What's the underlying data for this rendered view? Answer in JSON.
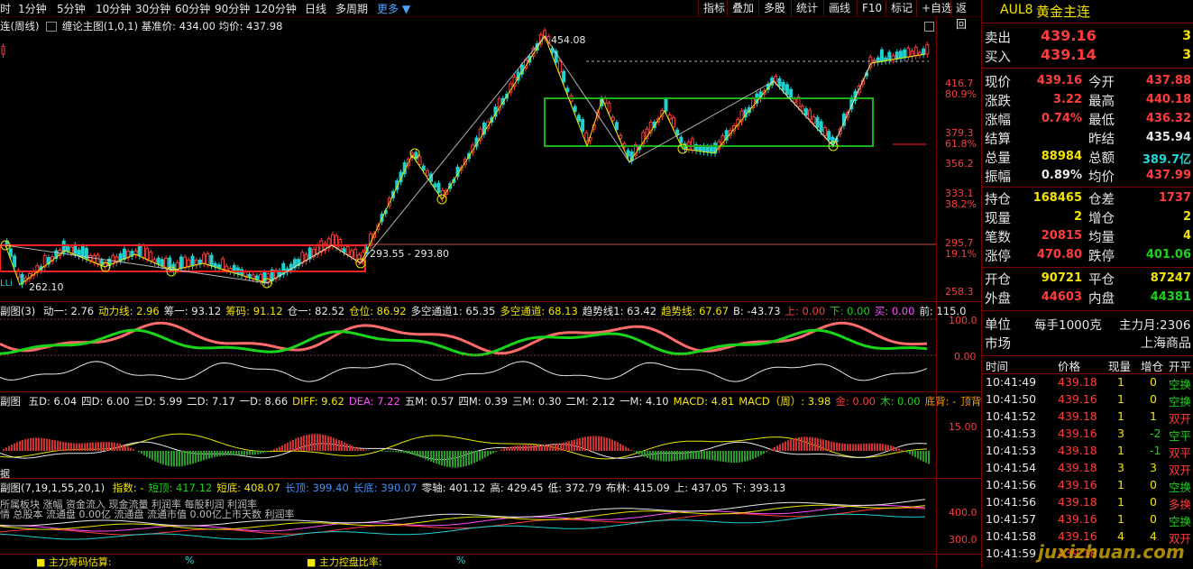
{
  "toolbar": {
    "periods": [
      "时",
      "1分钟",
      "5分钟",
      "10分钟",
      "30分钟",
      "60分钟",
      "90分钟",
      "120分钟",
      "日线",
      "多周期"
    ],
    "more": "更多",
    "tools": [
      "指标",
      "叠加",
      "多股",
      "统计",
      "画线",
      "F10",
      "标记",
      "+自选",
      "返回"
    ]
  },
  "main_pane": {
    "title_left": "连(周线)",
    "title_indicator": "缠论主图(1,0,1)",
    "title_base": "基准价: 434.00",
    "title_avg": "均价: 437.98",
    "axis_labels": [
      "416.7",
      "80.9%",
      "379.3",
      "61.8%",
      "356.2",
      "333.1",
      "38.2%",
      "295.7",
      "19.1%",
      "258.3"
    ],
    "annot_high": "454.08",
    "annot_low": "262.10",
    "annot_range": "293.55 - 293.80",
    "corner_text": "LLi"
  },
  "sub1": {
    "name": "副图(3)",
    "items": [
      {
        "k": "动一:",
        "v": "2.76",
        "c": "#e8e8e8"
      },
      {
        "k": "动力线:",
        "v": "2.96",
        "c": "#f5e400"
      },
      {
        "k": "筹一:",
        "v": "93.12",
        "c": "#e8e8e8"
      },
      {
        "k": "筹码:",
        "v": "91.12",
        "c": "#f5e400"
      },
      {
        "k": "仓一:",
        "v": "82.52",
        "c": "#e8e8e8"
      },
      {
        "k": "仓位:",
        "v": "86.92",
        "c": "#f5e400"
      },
      {
        "k": "多空通道1:",
        "v": "65.35",
        "c": "#e8e8e8"
      },
      {
        "k": "多空通道:",
        "v": "68.13",
        "c": "#f5e400"
      },
      {
        "k": "趋势线1:",
        "v": "63.42",
        "c": "#e8e8e8"
      },
      {
        "k": "趋势线:",
        "v": "67.67",
        "c": "#f5e400"
      },
      {
        "k": "B:",
        "v": "-43.73",
        "c": "#e8e8e8"
      },
      {
        "k": "上:",
        "v": "0.00",
        "c": "#ff3c3c"
      },
      {
        "k": "下:",
        "v": "0.00",
        "c": "#19d519"
      },
      {
        "k": "买:",
        "v": "0.00",
        "c": "#ff4dff"
      },
      {
        "k": "前:",
        "v": "115.0",
        "c": "#e8e8e8"
      }
    ],
    "axis": [
      "100.0",
      "0.00"
    ]
  },
  "sub2": {
    "name": "副图",
    "items": [
      {
        "k": "五D:",
        "v": "6.04",
        "c": "#e8e8e8"
      },
      {
        "k": "四D:",
        "v": "6.00",
        "c": "#e8e8e8"
      },
      {
        "k": "三D:",
        "v": "5.99",
        "c": "#e8e8e8"
      },
      {
        "k": "二D:",
        "v": "7.17",
        "c": "#e8e8e8"
      },
      {
        "k": "一D:",
        "v": "8.66",
        "c": "#e8e8e8"
      },
      {
        "k": "DIFF:",
        "v": "9.62",
        "c": "#f5e400"
      },
      {
        "k": "DEA:",
        "v": "7.22",
        "c": "#ff4dff"
      },
      {
        "k": "五M:",
        "v": "0.57",
        "c": "#e8e8e8"
      },
      {
        "k": "四M:",
        "v": "0.39",
        "c": "#e8e8e8"
      },
      {
        "k": "三M:",
        "v": "0.30",
        "c": "#e8e8e8"
      },
      {
        "k": "二M:",
        "v": "2.12",
        "c": "#e8e8e8"
      },
      {
        "k": "一M:",
        "v": "4.10",
        "c": "#e8e8e8"
      },
      {
        "k": "MACD:",
        "v": "4.81",
        "c": "#f5e400"
      },
      {
        "k": "MACD（周）:",
        "v": "3.98",
        "c": "#f5e400"
      },
      {
        "k": "金:",
        "v": "0.00",
        "c": "#ff3c3c"
      },
      {
        "k": "木:",
        "v": "0.00",
        "c": "#19d519"
      },
      {
        "k": "底背:",
        "v": "-",
        "c": "#ff9c00"
      },
      {
        "k": "顶背",
        "v": "",
        "c": "#ff9c00"
      }
    ],
    "axis": "15.00",
    "corner": "据"
  },
  "sub3": {
    "name": "副图(7,19,1,55,20,1)",
    "items": [
      {
        "k": "指数:",
        "v": "-",
        "c": "#f5e400"
      },
      {
        "k": "短顶:",
        "v": "417.12",
        "c": "#19d519"
      },
      {
        "k": "短底:",
        "v": "408.07",
        "c": "#f5e400"
      },
      {
        "k": "长顶:",
        "v": "399.40",
        "c": "#3f8fff"
      },
      {
        "k": "长底:",
        "v": "390.07",
        "c": "#3f8fff"
      },
      {
        "k": "零轴:",
        "v": "401.12",
        "c": "#e8e8e8"
      },
      {
        "k": "高:",
        "v": "429.45",
        "c": "#e8e8e8"
      },
      {
        "k": "低:",
        "v": "372.79",
        "c": "#e8e8e8"
      },
      {
        "k": "布林:",
        "v": "415.09",
        "c": "#e8e8e8"
      },
      {
        "k": "上:",
        "v": "437.05",
        "c": "#e8e8e8"
      },
      {
        "k": "下:",
        "v": "393.13",
        "c": "#e8e8e8"
      }
    ],
    "overlay1": "所属板块 涨幅 资金流入 现金流量 利润率 每股利润 利润率",
    "overlay2": "情 总股本 流通盘 0.00亿 流通盘 流通市值 0.00亿上市天数 利润率",
    "axis": [
      "400.0",
      "300.0"
    ],
    "footer1_label": "主力筹码估算:",
    "footer1_value": "%",
    "footer2_label": "主力控盘比率:",
    "footer2_value": "%"
  },
  "quote": {
    "code": "AUL8",
    "name": "黄金主连",
    "sell_label": "卖出",
    "sell_price": "439.16",
    "sell_vol": "3",
    "buy_label": "买入",
    "buy_price": "439.14",
    "buy_vol": "3",
    "rows": [
      {
        "l1": "现价",
        "v1": "439.16",
        "c1": "#ff3c3c",
        "l2": "今开",
        "v2": "437.88",
        "c2": "#ff3c3c"
      },
      {
        "l1": "涨跌",
        "v1": "3.22",
        "c1": "#ff3c3c",
        "l2": "最高",
        "v2": "440.18",
        "c2": "#ff3c3c"
      },
      {
        "l1": "涨幅",
        "v1": "0.74%",
        "c1": "#ff3c3c",
        "l2": "最低",
        "v2": "436.32",
        "c2": "#ff3c3c"
      },
      {
        "l1": "结算",
        "v1": "",
        "c1": "#e8e8e8",
        "l2": "昨结",
        "v2": "435.94",
        "c2": "#e8e8e8"
      },
      {
        "l1": "总量",
        "v1": "88984",
        "c1": "#f5e400",
        "l2": "总额",
        "v2": "389.7亿",
        "c2": "#23d6d6"
      },
      {
        "l1": "振幅",
        "v1": "0.89%",
        "c1": "#e8e8e8",
        "l2": "均价",
        "v2": "437.99",
        "c2": "#ff3c3c"
      }
    ],
    "rows2": [
      {
        "l1": "持仓",
        "v1": "168465",
        "c1": "#f5e400",
        "l2": "仓差",
        "v2": "1737",
        "c2": "#ff3c3c"
      },
      {
        "l1": "现量",
        "v1": "2",
        "c1": "#f5e400",
        "l2": "增仓",
        "v2": "2",
        "c2": "#f5e400"
      },
      {
        "l1": "笔数",
        "v1": "20815",
        "c1": "#ff3c3c",
        "l2": "均量",
        "v2": "4",
        "c2": "#f5e400"
      },
      {
        "l1": "涨停",
        "v1": "470.80",
        "c1": "#ff3c3c",
        "l2": "跌停",
        "v2": "401.06",
        "c2": "#19d519"
      }
    ],
    "rows3": [
      {
        "l1": "开仓",
        "v1": "90721",
        "c1": "#f5e400",
        "l2": "平仓",
        "v2": "87247",
        "c2": "#f5e400"
      },
      {
        "l1": "外盘",
        "v1": "44603",
        "c1": "#ff3c3c",
        "l2": "内盘",
        "v2": "44381",
        "c2": "#19d519"
      }
    ],
    "unit_label": "单位",
    "unit_value": "每手1000克",
    "main_month": "主力月:2306",
    "market_label": "市场",
    "market_value": "上海商品",
    "tick_headers": [
      "时间",
      "价格",
      "现量",
      "增仓",
      "开平"
    ],
    "ticks": [
      {
        "t": "10:41:49",
        "p": "439.18",
        "v": "1",
        "z": "0",
        "o": "空换",
        "oc": "#19d519"
      },
      {
        "t": "10:41:50",
        "p": "439.16",
        "v": "1",
        "z": "0",
        "o": "空换",
        "oc": "#19d519"
      },
      {
        "t": "10:41:52",
        "p": "439.18",
        "v": "1",
        "z": "1",
        "o": "双开",
        "oc": "#ff3c3c"
      },
      {
        "t": "10:41:53",
        "p": "439.16",
        "v": "3",
        "z": "-2",
        "o": "空平",
        "oc": "#19d519"
      },
      {
        "t": "10:41:53",
        "p": "439.18",
        "v": "1",
        "z": "-1",
        "o": "双平",
        "oc": "#ff3c3c"
      },
      {
        "t": "10:41:54",
        "p": "439.18",
        "v": "3",
        "z": "3",
        "o": "双开",
        "oc": "#ff3c3c"
      },
      {
        "t": "10:41:56",
        "p": "439.16",
        "v": "1",
        "z": "0",
        "o": "空换",
        "oc": "#19d519"
      },
      {
        "t": "10:41:56",
        "p": "439.18",
        "v": "1",
        "z": "0",
        "o": "多换",
        "oc": "#ff3c3c"
      },
      {
        "t": "10:41:57",
        "p": "439.16",
        "v": "1",
        "z": "0",
        "o": "空换",
        "oc": "#19d519"
      },
      {
        "t": "10:41:58",
        "p": "439.16",
        "v": "4",
        "z": "4",
        "o": "双开",
        "oc": "#ff3c3c"
      },
      {
        "t": "10:41:59",
        "p": "439.18",
        "v": "",
        "z": "",
        "o": "",
        "oc": "#ff3c3c"
      }
    ],
    "watermark": "juxizhuan.com"
  },
  "colors": {
    "up": "#ff3c3c",
    "down": "#19d519",
    "bg": "#000000",
    "frame": "#7a0000"
  }
}
